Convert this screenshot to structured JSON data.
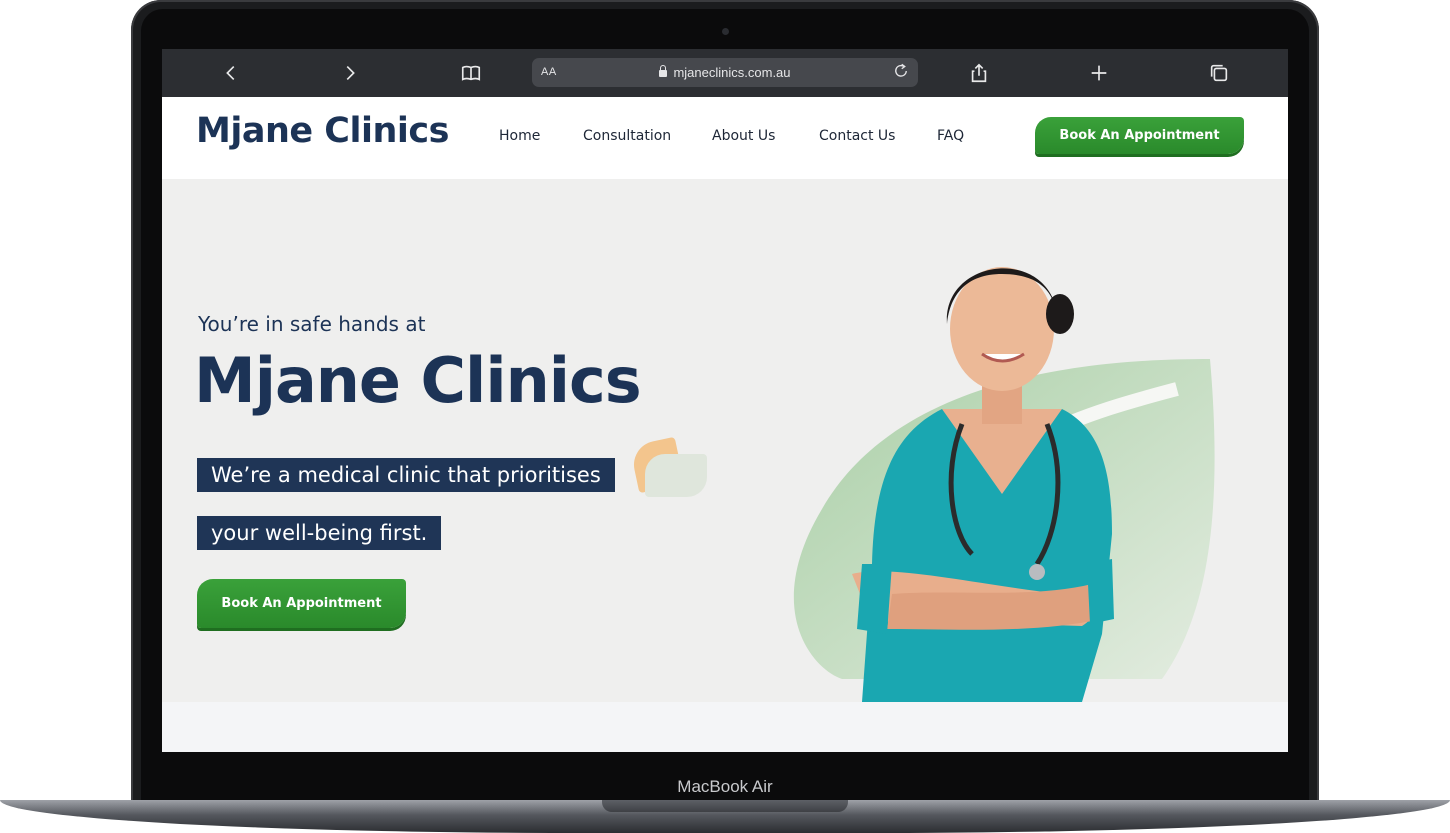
{
  "device": {
    "label": "MacBook Air"
  },
  "browser": {
    "aa_label": "AA",
    "url": "mjaneclinics.com.au"
  },
  "site": {
    "logo": "Mjane Clinics",
    "nav": [
      "Home",
      "Consultation",
      "About Us",
      "Contact Us",
      "FAQ"
    ],
    "nav_cta": "Book An Appointment"
  },
  "hero": {
    "tagline": "You’re in safe hands at",
    "brand": "Mjane Clinics",
    "highlight_1": "We’re a medical clinic that prioritises",
    "highlight_2": "your well-being first.",
    "cta": "Book An Appointment"
  },
  "colors": {
    "navy": "#1c3356",
    "green": "#3aa13a",
    "hero_bg": "#efefee",
    "scrubs": "#1aa7b1"
  }
}
